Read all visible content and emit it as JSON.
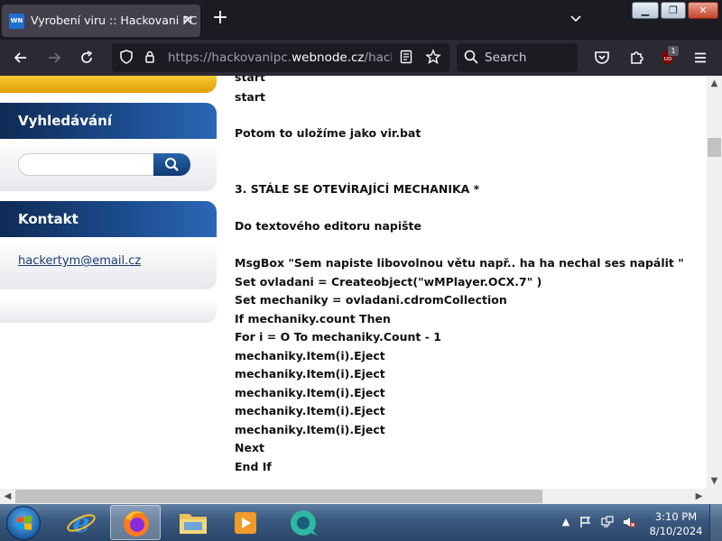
{
  "browser": {
    "tab": {
      "favicon": "WN",
      "title": "Vyrobení viru :: Hackovani PC"
    },
    "url": {
      "prefix": "https://hackovanipc.",
      "domain": "webnode.cz",
      "path": "/hacking"
    },
    "search_placeholder": "Search",
    "extension_badge": "1",
    "icons": [
      "back-icon",
      "forward-icon",
      "reload-icon",
      "shield-icon",
      "page-icon",
      "reader-view-icon",
      "bookmark-star-icon",
      "search-icon",
      "pocket-icon",
      "extensions-icon",
      "ublock-icon",
      "menu-icon",
      "new-tab-icon",
      "close-tab-icon",
      "list-tabs-icon"
    ]
  },
  "sidebar": {
    "search_title": "Vyhledávání",
    "search_value": "",
    "contact_title": "Kontakt",
    "contact_email": "hackertym@email.cz"
  },
  "content": {
    "lines": [
      "start",
      "start",
      "Potom to uložíme jako vir.bat",
      "3. STÁLE SE OTEVÍRAJÍCÍ MECHANIKA *",
      "Do textového editoru napište",
      "MsgBox \"Sem napiste libovolnou větu např.. ha ha nechal ses napálit \"",
      "Set ovladani = Createobject(\"wMPlayer.OCX.7\" )",
      "Set mechaniky = ovladani.cdromCollection",
      "If mechaniky.count Then",
      "For i = O To mechaniky.Count - 1",
      "mechaniky.Item(i).Eject",
      "mechaniky.Item(i).Eject",
      "mechaniky.Item(i).Eject",
      "mechaniky.Item(i).Eject",
      "mechaniky.Item(i).Eject",
      "Next",
      "End If"
    ]
  },
  "taskbar": {
    "time": "3:10 PM",
    "date": "8/10/2024",
    "apps": [
      "internet-explorer-icon",
      "firefox-icon",
      "file-explorer-icon",
      "media-player-icon",
      "chat-app-icon"
    ]
  }
}
